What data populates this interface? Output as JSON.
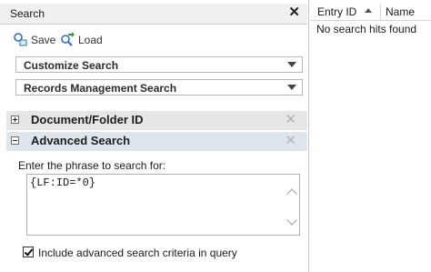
{
  "search_pane": {
    "title": "Search",
    "close_icon_glyph": "✕",
    "toolbar": {
      "save_label": "Save",
      "load_label": "Load"
    },
    "dropdowns": {
      "customize": "Customize Search",
      "records": "Records Management Search"
    },
    "sections": {
      "docid": {
        "title": "Document/Folder ID",
        "expanded": false
      },
      "advanced": {
        "title": "Advanced Search",
        "expanded": true
      }
    },
    "advanced": {
      "phrase_label": "Enter the phrase to search for:",
      "phrase_value": "{LF:ID=*0}",
      "include_label": "Include advanced search criteria in query",
      "include_checked": true
    }
  },
  "results_pane": {
    "columns": {
      "entry_id": "Entry ID",
      "name": "Name"
    },
    "sort": "ascending",
    "empty_message": "No search hits found"
  },
  "colors": {
    "header_bg": "#f0f0f0",
    "section_bg": "#e6e6e6",
    "section_selected_bg": "#dfe5ec",
    "save_icon": "#2f6fb8",
    "load_icon": "#2f6fb8",
    "load_arrow": "#2e9b3c"
  }
}
